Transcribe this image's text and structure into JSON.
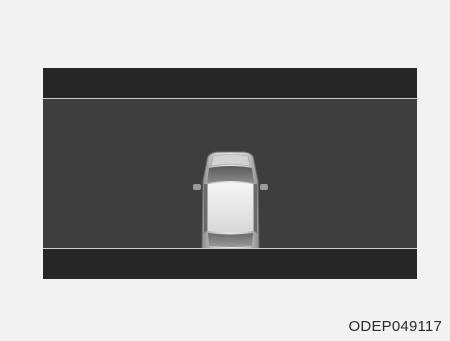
{
  "figure": {
    "code": "ODEP049117",
    "icon": "vehicle-top-view-icon"
  },
  "colors": {
    "page_background": "#f2f2f2",
    "display_bar": "#262626",
    "display_main": "#3e3e3e",
    "divider": "#cfcfcf"
  }
}
